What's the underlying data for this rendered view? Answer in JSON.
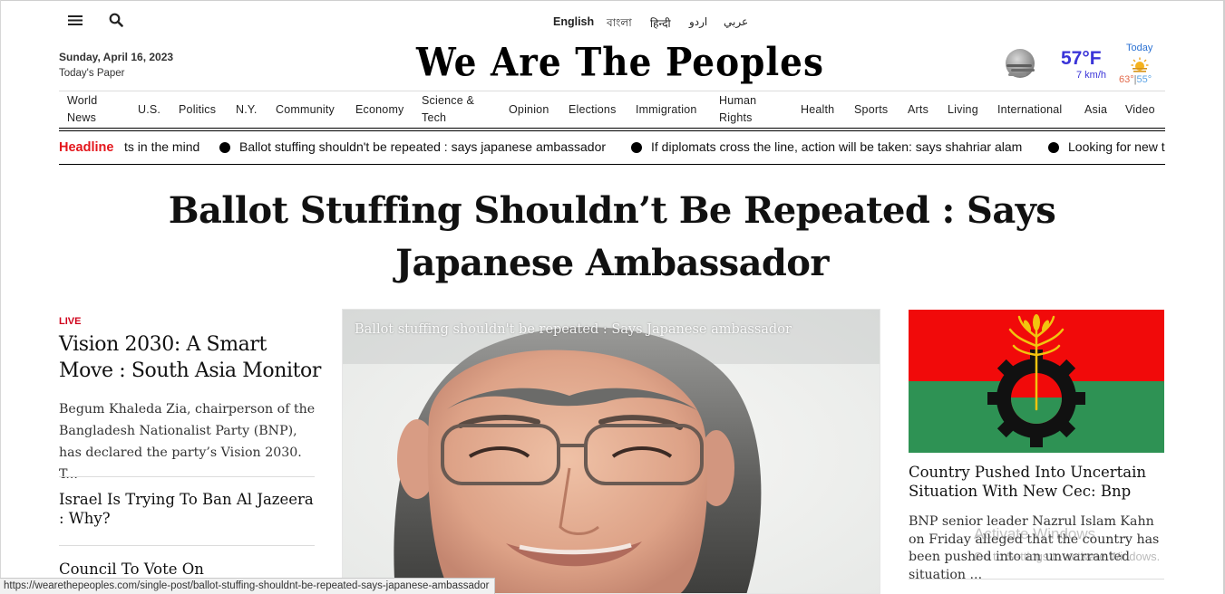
{
  "languages": [
    {
      "label": "English",
      "active": true
    },
    {
      "label": "বাংলা"
    },
    {
      "label": "हिन्दी"
    },
    {
      "label": "اردو"
    },
    {
      "label": "عربي"
    }
  ],
  "header": {
    "date": "Sunday, April 16, 2023",
    "todays_paper": "Today's Paper",
    "site_title": "We Are The Peoples"
  },
  "weather": {
    "condition_icon": "cloud-moon-icon",
    "temperature": "57°F",
    "wind": "7 km/h",
    "today_label": "Today",
    "today_icon": "sun-icon",
    "high": "63°",
    "separator": "|",
    "low": "55°",
    "colors": {
      "temp": "#3a34d8",
      "high": "#e26a4b",
      "low": "#5aa3e6"
    }
  },
  "nav": {
    "items": [
      "World News",
      "U.S.",
      "Politics",
      "N.Y.",
      "Community",
      "Economy",
      "Science & Tech",
      "Opinion",
      "Elections",
      "Immigration",
      "Human Rights",
      "Health",
      "Sports",
      "Arts",
      "Living",
      "International",
      "Asia",
      "Video"
    ]
  },
  "ticker": {
    "label": "Headline",
    "items": [
      "ts in the mind",
      "Ballot stuffing shouldn't be repeated : says japanese ambassador",
      "If diplomats cross the line, action will be taken: says shahriar alam",
      "Looking for new t"
    ],
    "label_color": "#e4161c"
  },
  "main": {
    "headline": "Ballot Stuffing Shouldn’t Be Repeated : Says Japanese Ambassador"
  },
  "left_column": {
    "live_label": "LIVE",
    "stories": [
      {
        "title": "Vision 2030: A Smart Move : South Asia Monitor",
        "summary": "Begum Khaleda Zia, chairperson of the Bangladesh Nationalist Party (BNP), has declared the party’s Vision 2030. T..."
      },
      {
        "title": "Israel Is Trying To Ban Al Jazeera : Why?"
      },
      {
        "title": "Council To Vote On Implementation"
      }
    ]
  },
  "center": {
    "photo_caption": "Ballot stuffing shouldn't be repeated : Says Japanese ambassador"
  },
  "right_column": {
    "story_title": "Country Pushed Into Uncertain Situation With New Cec: Bnp",
    "story_summary": "BNP senior leader Nazrul Islam Kahn on Friday alleged that the country has been pushed into an unwarranted situation ..."
  },
  "os_overlay": {
    "line1": "Activate Windows",
    "line2": "Go to Settings to activate Windows."
  },
  "status_bar": {
    "url": "https://wearethepeoples.com/single-post/ballot-stuffing-shouldnt-be-repeated-says-japanese-ambassador"
  }
}
